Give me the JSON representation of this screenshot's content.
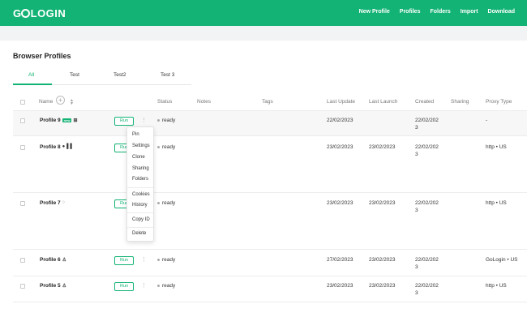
{
  "header": {
    "logo": {
      "pre": "G",
      "post": "LOGIN"
    },
    "nav": [
      "New Profile",
      "Profiles",
      "Folders",
      "Import",
      "Download"
    ]
  },
  "page": {
    "title": "Browser Profiles"
  },
  "tabs": [
    "All",
    "Test",
    "Test2",
    "Test 3"
  ],
  "columns": {
    "name": "Name",
    "status": "Status",
    "notes": "Notes",
    "tags": "Tags",
    "last_update": "Last Update",
    "last_launch": "Last Launch",
    "created": "Created",
    "sharing": "Sharing",
    "proxy_type": "Proxy Type"
  },
  "run_label": "Run",
  "rows": [
    {
      "name": "Profile 9",
      "badge": "new",
      "status": "ready",
      "last_update": "22/02/2023",
      "last_launch": "",
      "created": [
        "22/02/202",
        "3"
      ],
      "proxy": "-"
    },
    {
      "name": "Profile 8",
      "badge": "",
      "status": "ready",
      "last_update": "23/02/2023",
      "last_launch": "23/02/2023",
      "created": [
        "22/02/202",
        "3"
      ],
      "proxy": "http • US"
    },
    {
      "name": "Profile 7",
      "badge": "",
      "status": "ready",
      "last_update": "23/02/2023",
      "last_launch": "23/02/2023",
      "created": [
        "22/02/202",
        "3"
      ],
      "proxy": "http • US"
    },
    {
      "name": "Profile 6",
      "badge": "",
      "status": "ready",
      "last_update": "27/02/2023",
      "last_launch": "23/02/2023",
      "created": [
        "22/02/202",
        "3"
      ],
      "proxy": "GoLogin • US"
    },
    {
      "name": "Profile 5",
      "badge": "",
      "status": "ready",
      "last_update": "23/02/2023",
      "last_launch": "23/02/2023",
      "created": [
        "22/02/202",
        "3"
      ],
      "proxy": "http • US"
    }
  ],
  "context_menu": [
    "Pin",
    "Settings",
    "Clone",
    "Sharing",
    "Folders",
    "Cookies",
    "History",
    "Copy ID",
    "Delete"
  ],
  "colors": {
    "brand": "#12b374"
  }
}
